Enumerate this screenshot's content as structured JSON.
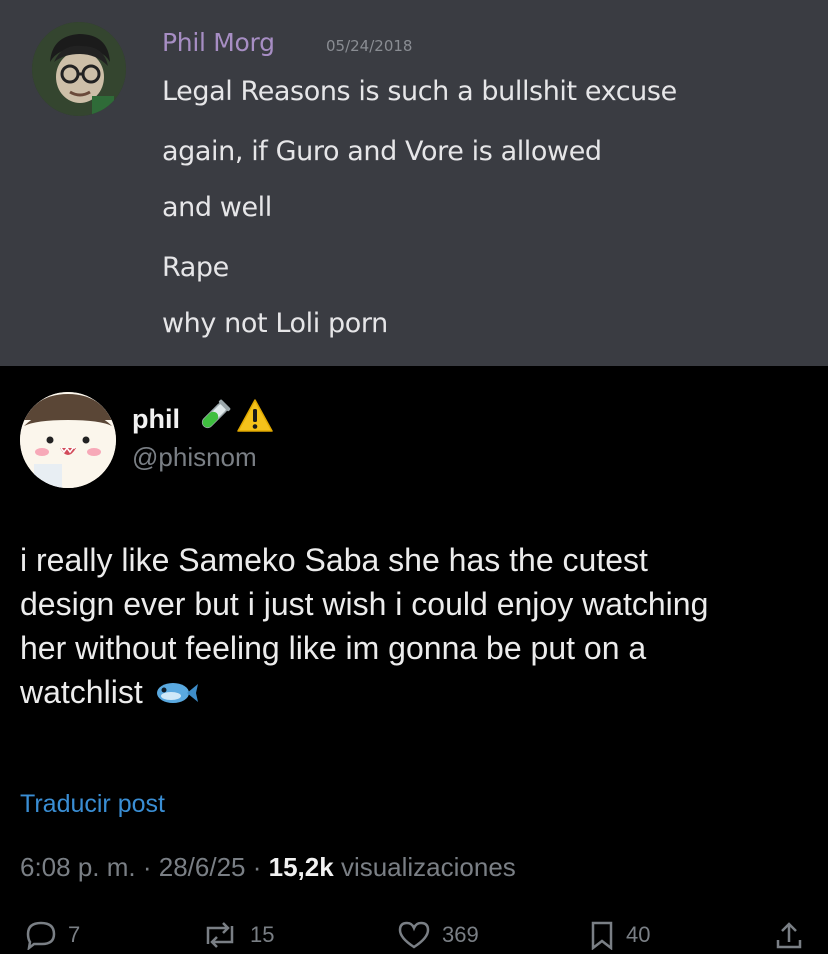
{
  "discord": {
    "author": "Phil Morg",
    "date": "05/24/2018",
    "lines": [
      "Legal Reasons is such a bullshit excuse",
      "again, if Guro and Vore is allowed",
      "and well",
      "Rape",
      "why not Loli porn"
    ]
  },
  "tweet": {
    "display_name": "phil",
    "badges": [
      "test-tube-icon",
      "warning-icon"
    ],
    "handle": "@phisnom",
    "body_lines": [
      "i really like Sameko Saba she has the cutest",
      "design ever but i just wish i could enjoy watching",
      "her without feeling like im gonna be put on a",
      "watchlist"
    ],
    "body_emoji": "fish-icon",
    "translate_label": "Traducir post",
    "time": "6:08 p. m.",
    "date": "28/6/25",
    "views_count": "15,2k",
    "views_label": "visualizaciones",
    "actions": {
      "replies": "7",
      "reposts": "15",
      "likes": "369",
      "bookmarks": "40"
    }
  }
}
